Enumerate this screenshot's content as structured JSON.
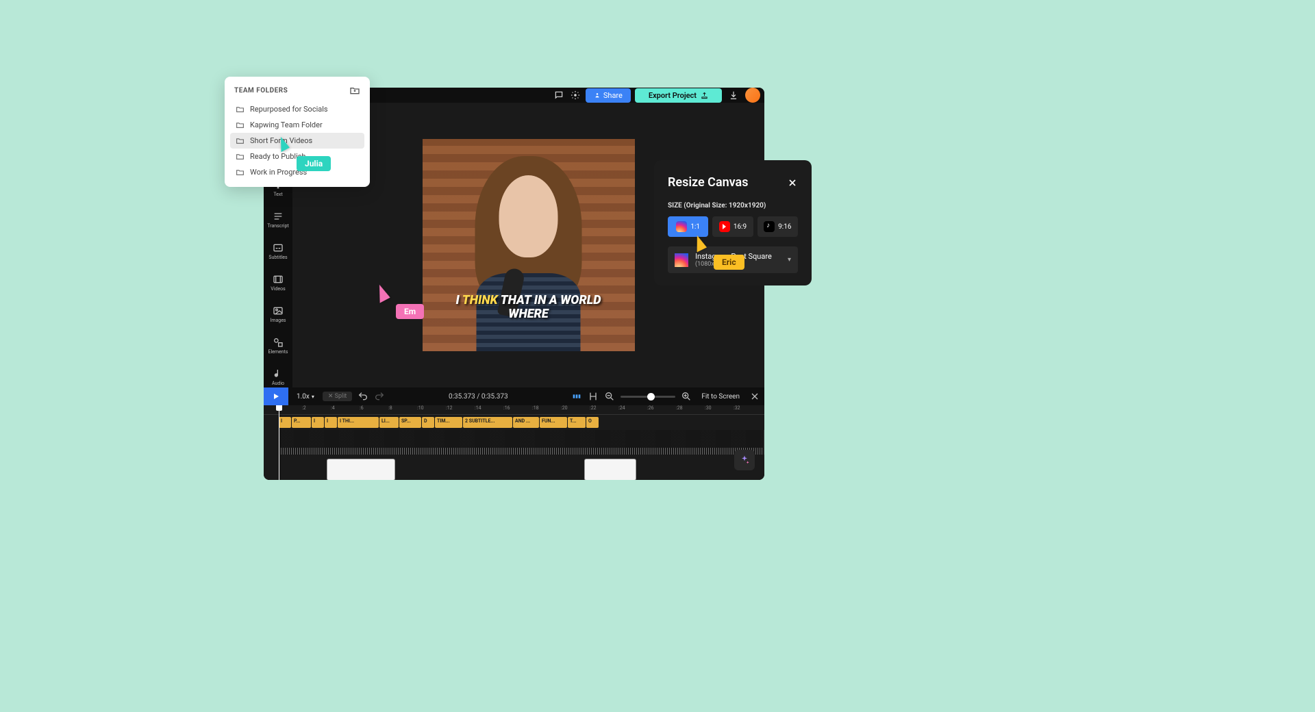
{
  "topbar": {
    "share": "Share",
    "export": "Export Project"
  },
  "sidebar": {
    "items": [
      {
        "label": "Text"
      },
      {
        "label": "Transcript"
      },
      {
        "label": "Subtitles"
      },
      {
        "label": "Videos"
      },
      {
        "label": "Images"
      },
      {
        "label": "Elements"
      },
      {
        "label": "Audio"
      }
    ]
  },
  "caption": {
    "line1_pre": "I ",
    "line1_hl": "THINK",
    "line1_post": " THAT IN A WORLD",
    "line2": "WHERE"
  },
  "playback": {
    "speed": "1.0x",
    "split": "✕ Split",
    "current": "0:35.373",
    "total": "0:35.373",
    "fit": "Fit to Screen"
  },
  "ruler_ticks": [
    ":2",
    ":4",
    ":6",
    ":8",
    ":10",
    ":12",
    ":14",
    ":16",
    ":18",
    ":20",
    ":22",
    ":24",
    ":26",
    ":28",
    ":30",
    ":32"
  ],
  "subtitle_segments": [
    "I",
    "P...",
    "I",
    "I",
    "I THI...",
    "LI...",
    "SP...",
    "D",
    "TIM...",
    "2 SUBTITLE...",
    "AND ...",
    "FUN...",
    "T...",
    "O"
  ],
  "folders": {
    "title": "TEAM FOLDERS",
    "items": [
      "Repurposed for Socials",
      "Kapwing Team Folder",
      "Short Form Videos",
      "Ready to Publish",
      "Work in Progress"
    ]
  },
  "cursors": {
    "julia": "Julia",
    "em": "Em",
    "eric": "Eric"
  },
  "resize": {
    "title": "Resize Canvas",
    "size_label": "SIZE (Original Size: 1920x1920)",
    "ratios": [
      {
        "label": "1:1"
      },
      {
        "label": "16:9"
      },
      {
        "label": "9:16"
      }
    ],
    "preset_name": "Instagram Post Square",
    "preset_dims": "(1080x1080, 1:1)"
  }
}
